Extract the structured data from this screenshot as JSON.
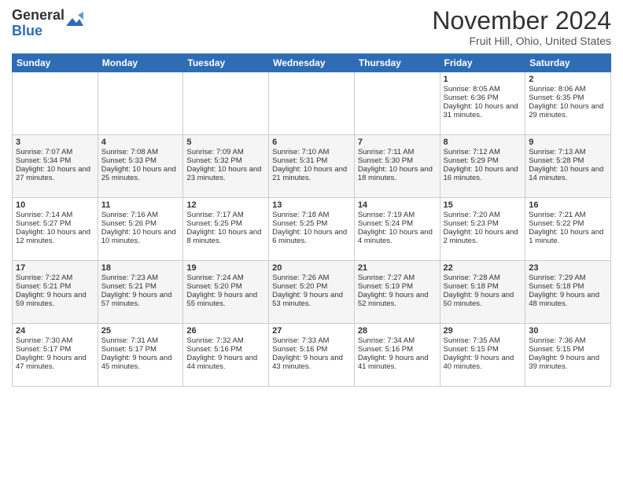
{
  "logo": {
    "general": "General",
    "blue": "Blue"
  },
  "header": {
    "month": "November 2024",
    "location": "Fruit Hill, Ohio, United States"
  },
  "weekdays": [
    "Sunday",
    "Monday",
    "Tuesday",
    "Wednesday",
    "Thursday",
    "Friday",
    "Saturday"
  ],
  "weeks": [
    [
      {
        "day": "",
        "content": ""
      },
      {
        "day": "",
        "content": ""
      },
      {
        "day": "",
        "content": ""
      },
      {
        "day": "",
        "content": ""
      },
      {
        "day": "",
        "content": ""
      },
      {
        "day": "1",
        "content": "Sunrise: 8:05 AM\nSunset: 6:36 PM\nDaylight: 10 hours and 31 minutes."
      },
      {
        "day": "2",
        "content": "Sunrise: 8:06 AM\nSunset: 6:35 PM\nDaylight: 10 hours and 29 minutes."
      }
    ],
    [
      {
        "day": "3",
        "content": "Sunrise: 7:07 AM\nSunset: 5:34 PM\nDaylight: 10 hours and 27 minutes."
      },
      {
        "day": "4",
        "content": "Sunrise: 7:08 AM\nSunset: 5:33 PM\nDaylight: 10 hours and 25 minutes."
      },
      {
        "day": "5",
        "content": "Sunrise: 7:09 AM\nSunset: 5:32 PM\nDaylight: 10 hours and 23 minutes."
      },
      {
        "day": "6",
        "content": "Sunrise: 7:10 AM\nSunset: 5:31 PM\nDaylight: 10 hours and 21 minutes."
      },
      {
        "day": "7",
        "content": "Sunrise: 7:11 AM\nSunset: 5:30 PM\nDaylight: 10 hours and 18 minutes."
      },
      {
        "day": "8",
        "content": "Sunrise: 7:12 AM\nSunset: 5:29 PM\nDaylight: 10 hours and 16 minutes."
      },
      {
        "day": "9",
        "content": "Sunrise: 7:13 AM\nSunset: 5:28 PM\nDaylight: 10 hours and 14 minutes."
      }
    ],
    [
      {
        "day": "10",
        "content": "Sunrise: 7:14 AM\nSunset: 5:27 PM\nDaylight: 10 hours and 12 minutes."
      },
      {
        "day": "11",
        "content": "Sunrise: 7:16 AM\nSunset: 5:26 PM\nDaylight: 10 hours and 10 minutes."
      },
      {
        "day": "12",
        "content": "Sunrise: 7:17 AM\nSunset: 5:25 PM\nDaylight: 10 hours and 8 minutes."
      },
      {
        "day": "13",
        "content": "Sunrise: 7:18 AM\nSunset: 5:25 PM\nDaylight: 10 hours and 6 minutes."
      },
      {
        "day": "14",
        "content": "Sunrise: 7:19 AM\nSunset: 5:24 PM\nDaylight: 10 hours and 4 minutes."
      },
      {
        "day": "15",
        "content": "Sunrise: 7:20 AM\nSunset: 5:23 PM\nDaylight: 10 hours and 2 minutes."
      },
      {
        "day": "16",
        "content": "Sunrise: 7:21 AM\nSunset: 5:22 PM\nDaylight: 10 hours and 1 minute."
      }
    ],
    [
      {
        "day": "17",
        "content": "Sunrise: 7:22 AM\nSunset: 5:21 PM\nDaylight: 9 hours and 59 minutes."
      },
      {
        "day": "18",
        "content": "Sunrise: 7:23 AM\nSunset: 5:21 PM\nDaylight: 9 hours and 57 minutes."
      },
      {
        "day": "19",
        "content": "Sunrise: 7:24 AM\nSunset: 5:20 PM\nDaylight: 9 hours and 55 minutes."
      },
      {
        "day": "20",
        "content": "Sunrise: 7:26 AM\nSunset: 5:20 PM\nDaylight: 9 hours and 53 minutes."
      },
      {
        "day": "21",
        "content": "Sunrise: 7:27 AM\nSunset: 5:19 PM\nDaylight: 9 hours and 52 minutes."
      },
      {
        "day": "22",
        "content": "Sunrise: 7:28 AM\nSunset: 5:18 PM\nDaylight: 9 hours and 50 minutes."
      },
      {
        "day": "23",
        "content": "Sunrise: 7:29 AM\nSunset: 5:18 PM\nDaylight: 9 hours and 48 minutes."
      }
    ],
    [
      {
        "day": "24",
        "content": "Sunrise: 7:30 AM\nSunset: 5:17 PM\nDaylight: 9 hours and 47 minutes."
      },
      {
        "day": "25",
        "content": "Sunrise: 7:31 AM\nSunset: 5:17 PM\nDaylight: 9 hours and 45 minutes."
      },
      {
        "day": "26",
        "content": "Sunrise: 7:32 AM\nSunset: 5:16 PM\nDaylight: 9 hours and 44 minutes."
      },
      {
        "day": "27",
        "content": "Sunrise: 7:33 AM\nSunset: 5:16 PM\nDaylight: 9 hours and 43 minutes."
      },
      {
        "day": "28",
        "content": "Sunrise: 7:34 AM\nSunset: 5:16 PM\nDaylight: 9 hours and 41 minutes."
      },
      {
        "day": "29",
        "content": "Sunrise: 7:35 AM\nSunset: 5:15 PM\nDaylight: 9 hours and 40 minutes."
      },
      {
        "day": "30",
        "content": "Sunrise: 7:36 AM\nSunset: 5:15 PM\nDaylight: 9 hours and 39 minutes."
      }
    ]
  ]
}
